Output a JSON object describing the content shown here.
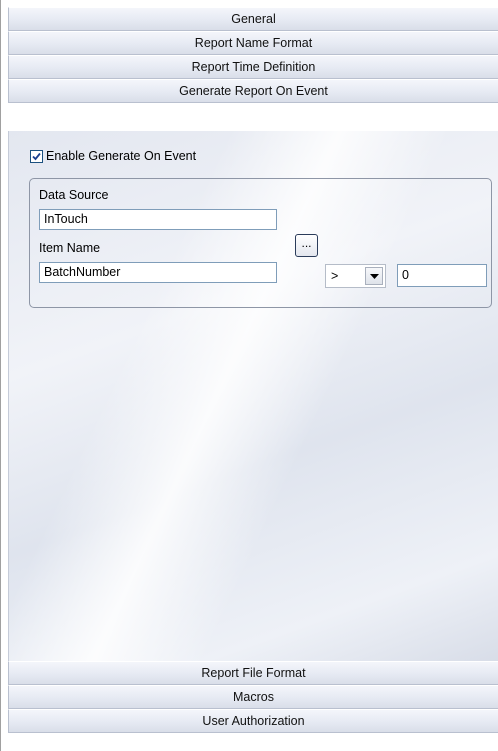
{
  "sections": {
    "general": "General",
    "report_name_format": "Report Name Format",
    "report_time_definition": "Report Time Definition",
    "generate_report_on_event": "Generate Report On Event",
    "report_file_format": "Report File Format",
    "macros": "Macros",
    "user_authorization": "User Authorization"
  },
  "event": {
    "enable_label": "Enable Generate On Event",
    "enable_checked": true,
    "data_source_label": "Data Source",
    "data_source_value": "InTouch",
    "item_name_label": "Item Name",
    "item_name_value": "BatchNumber",
    "browse_label": "...",
    "operator_value": ">",
    "compare_value": "0"
  }
}
